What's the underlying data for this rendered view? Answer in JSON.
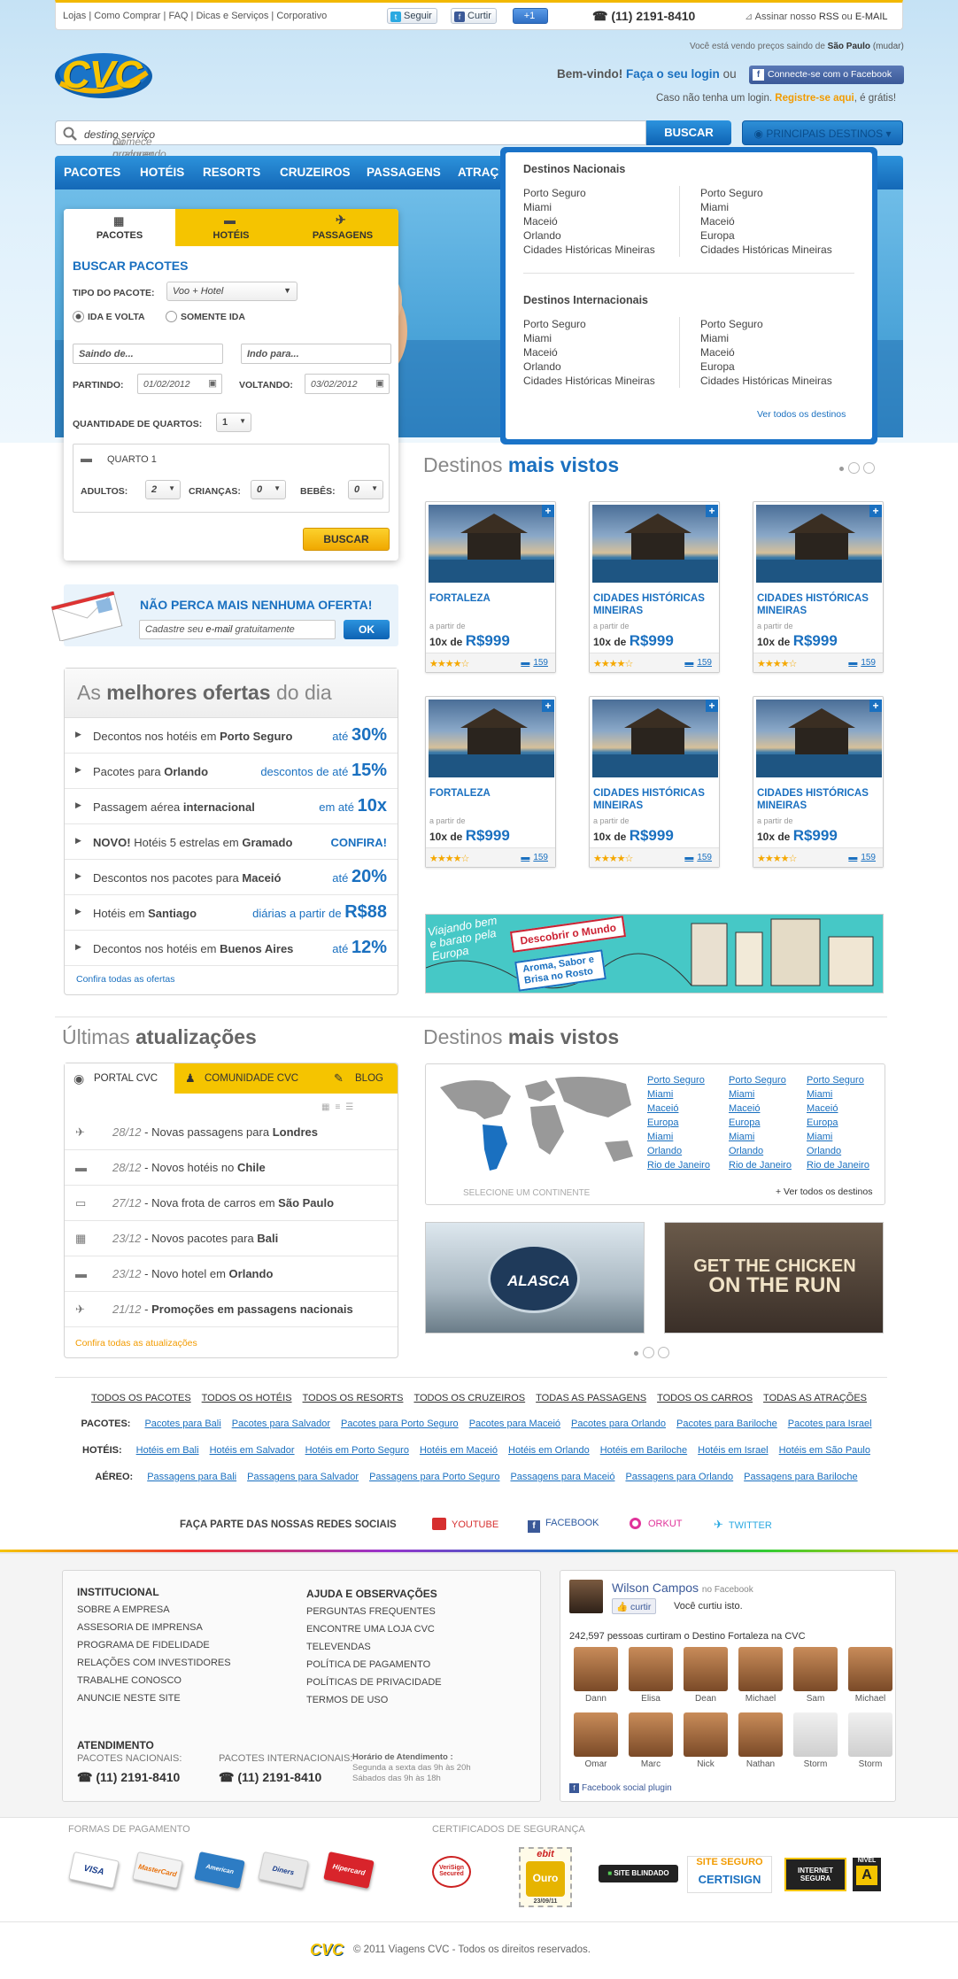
{
  "topbar": {
    "links": [
      "Lojas",
      "Como Comprar",
      "FAQ",
      "Dicas e Serviços",
      "Corporativo"
    ],
    "twitter_label": "Seguir",
    "facebook_label": "Curtir",
    "gplus_label": "+1",
    "phone": "(11) 2191-8410",
    "rss_prefix": "Assinar nosso",
    "rss_label": "RSS",
    "rss_or": "ou",
    "email_label": "E-MAIL"
  },
  "header": {
    "logo_text": "CVC",
    "location_prefix": "Você está vendo preços saindo de",
    "location_city": "São Paulo",
    "location_change": "(mudar)",
    "welcome": "Bem-vindo!",
    "login_link": "Faça o seu login",
    "or": "ou",
    "facebook_connect": "Connecte-se com o Facebook",
    "no_login": "Caso não tenha um login.",
    "register_link": "Registre-se aqui",
    "register_suffix": ", é grátis!"
  },
  "search": {
    "placeholder_a": "Comece procurando o seu",
    "placeholder_b": "destino",
    "placeholder_c": "ou qualquer outro",
    "placeholder_d": "serviço",
    "placeholder_e": "...",
    "button": "BUSCAR",
    "destinations_button": "PRINCIPAIS DESTINOS"
  },
  "nav": [
    "PACOTES",
    "HOTÉIS",
    "RESORTS",
    "CRUZEIROS",
    "PASSAGENS",
    "ATRAÇ"
  ],
  "dropdown": {
    "national_title": "Destinos Nacionais",
    "national_col1": [
      "Porto Seguro",
      "Miami",
      "Maceió",
      "Orlando",
      "Cidades Históricas Mineiras"
    ],
    "national_col2": [
      "Porto Seguro",
      "Miami",
      "Maceió",
      "Europa",
      "Cidades Históricas Mineiras"
    ],
    "intl_title": "Destinos Internacionais",
    "intl_col1": [
      "Porto Seguro",
      "Miami",
      "Maceió",
      "Orlando",
      "Cidades Históricas Mineiras"
    ],
    "intl_col2": [
      "Porto Seguro",
      "Miami",
      "Maceió",
      "Europa",
      "Cidades Históricas Mineiras"
    ],
    "see_all": "Ver todos os destinos"
  },
  "booking": {
    "tabs": [
      "PACOTES",
      "HOTÉIS",
      "PASSAGENS"
    ],
    "title": "BUSCAR PACOTES",
    "package_type_label": "TIPO DO PACOTE:",
    "package_type_value": "Voo + Hotel",
    "radio_roundtrip": "IDA E VOLTA",
    "radio_oneway": "SOMENTE IDA",
    "from_placeholder": "Saindo de...",
    "to_placeholder": "Indo para...",
    "depart_label": "PARTINDO:",
    "depart_value": "01/02/2012",
    "return_label": "VOLTANDO:",
    "return_value": "03/02/2012",
    "rooms_label": "QUANTIDADE DE QUARTOS:",
    "rooms_value": "1",
    "room_title": "QUARTO 1",
    "adults_label": "ADULTOS:",
    "adults_value": "2",
    "children_label": "CRIANÇAS:",
    "children_value": "0",
    "babies_label": "BEBÊS:",
    "babies_value": "0",
    "button": "BUSCAR"
  },
  "newsletter": {
    "title": "NÃO PERCA MAIS NENHUMA OFERTA!",
    "placeholder_a": "Cadastre seu",
    "placeholder_b": "e-mail",
    "placeholder_c": "gratuitamente",
    "button": "OK"
  },
  "offers": {
    "title_a": "As",
    "title_b": "melhores ofertas",
    "title_c": "do dia",
    "rows": [
      {
        "a": "Decontos nos hotéis em ",
        "b": "Porto Seguro",
        "pre": "até ",
        "val": "30%"
      },
      {
        "a": "Pacotes para ",
        "b": "Orlando",
        "pre": "descontos de até ",
        "val": "15%"
      },
      {
        "a": "Passagem aérea ",
        "b": "internacional",
        "pre": "em até ",
        "val": "10x"
      },
      {
        "a": "",
        "b": "NOVO!",
        "a2": " Hotéis 5 estrelas em ",
        "b2": "Gramado",
        "pre": "",
        "val": "CONFIRA!"
      },
      {
        "a": "Descontos nos pacotes para ",
        "b": "Maceió",
        "pre": "até ",
        "val": "20%"
      },
      {
        "a": "Hotéis em ",
        "b": "Santiago",
        "pre": "diárias a partir de ",
        "val": "R$88"
      },
      {
        "a": "Decontos nos hotéis em ",
        "b": "Buenos Aires",
        "pre": "até ",
        "val": "12%"
      }
    ],
    "see_all": "Confira todas as ofertas"
  },
  "destinos": {
    "title_a": "Destinos",
    "title_b": "mais vistos",
    "cards": [
      {
        "name": "FORTALEZA",
        "from": "a partir de",
        "installments": "10x de",
        "price": "R$999",
        "count": "159",
        "rating": 3.5
      },
      {
        "name": "CIDADES HISTÓRICAS MINEIRAS",
        "from": "a partir de",
        "installments": "10x de",
        "price": "R$999",
        "count": "159",
        "rating": 3.5
      },
      {
        "name": "CIDADES HISTÓRICAS MINEIRAS",
        "from": "a partir de",
        "installments": "10x de",
        "price": "R$999",
        "count": "159",
        "rating": 3.5
      },
      {
        "name": "FORTALEZA",
        "from": "a partir de",
        "installments": "10x de",
        "price": "R$999",
        "count": "159",
        "rating": 3.5
      },
      {
        "name": "CIDADES HISTÓRICAS MINEIRAS",
        "from": "a partir de",
        "installments": "10x de",
        "price": "R$999",
        "count": "159",
        "rating": 3.5
      },
      {
        "name": "CIDADES HISTÓRICAS MINEIRAS",
        "from": "a partir de",
        "installments": "10x de",
        "price": "R$999",
        "count": "159",
        "rating": 3.5
      }
    ]
  },
  "banner": {
    "left": "Viajando bem e barato pela Europa",
    "center": "Descobrir o Mundo",
    "bottom": "Aroma, Sabor e Brisa no Rosto"
  },
  "updates": {
    "title_a": "Últimas",
    "title_b": "atualizações",
    "tabs": [
      "PORTAL CVC",
      "COMUNIDADE CVC",
      "BLOG"
    ],
    "rows": [
      {
        "date": "28/12",
        "text": " - Novas passagens para ",
        "bold": "Londres"
      },
      {
        "date": "28/12",
        "text": " - Novos hotéis no ",
        "bold": "Chile"
      },
      {
        "date": "27/12",
        "text": " - Nova frota de carros em ",
        "bold": "São Paulo"
      },
      {
        "date": "23/12",
        "text": " - Novos pacotes para ",
        "bold": "Bali"
      },
      {
        "date": "23/12",
        "text": " - Novo hotel em ",
        "bold": "Orlando"
      },
      {
        "date": "21/12",
        "text": " - ",
        "bold": "Promoções em passagens nacionais"
      }
    ],
    "see_all": "Confira todas as atualizações"
  },
  "map": {
    "title_a": "Destinos",
    "title_b": "mais vistos",
    "col1": [
      "Porto Seguro",
      "Miami",
      "Maceió",
      "Europa",
      "Miami",
      "Orlando",
      "Rio de Janeiro"
    ],
    "col2": [
      "Porto Seguro",
      "Miami",
      "Maceió",
      "Europa",
      "Miami",
      "Orlando",
      "Rio de Janeiro"
    ],
    "col3": [
      "Porto Seguro",
      "Miami",
      "Maceió",
      "Europa",
      "Miami",
      "Orlando",
      "Rio de Janeiro"
    ],
    "select_continent": "SELECIONE UM CONTINENTE",
    "see_all": "+ Ver todos os destinos",
    "promo1": "ALASCA",
    "promo2_a": "GET THE CHICKEN",
    "promo2_b": "ON THE RUN"
  },
  "footer_nav": {
    "main": [
      "TODOS OS PACOTES",
      "TODOS OS HOTÉIS",
      "TODOS OS RESORTS",
      "TODOS OS CRUZEIROS",
      "TODAS AS PASSAGENS",
      "TODOS OS CARROS",
      "TODAS AS ATRAÇÕES"
    ],
    "pacotes_label": "PACOTES:",
    "pacotes": [
      "Pacotes para Bali",
      "Pacotes para Salvador",
      "Pacotes para Porto Seguro",
      "Pacotes para Maceió",
      "Pacotes para Orlando",
      "Pacotes para Bariloche",
      "Pacotes para Israel"
    ],
    "hoteis_label": "HOTÉIS:",
    "hoteis": [
      "Hotéis em Bali",
      "Hotéis em Salvador",
      "Hotéis em Porto Seguro",
      "Hotéis em Maceió",
      "Hotéis em Orlando",
      "Hotéis em Bariloche",
      "Hotéis em Israel",
      "Hotéis em São Paulo"
    ],
    "aereo_label": "AÉREO:",
    "aereo": [
      "Passagens para Bali",
      "Passagens para Salvador",
      "Passagens para Porto Seguro",
      "Passagens para Maceió",
      "Passagens para Orlando",
      "Passagens para Bariloche"
    ]
  },
  "social": {
    "label": "FAÇA PARTE DAS NOSSAS REDES SOCIAIS",
    "youtube": "YOUTUBE",
    "facebook": "FACEBOOK",
    "orkut": "ORKUT",
    "twitter": "TWITTER"
  },
  "footer": {
    "inst_title": "INSTITUCIONAL",
    "inst": [
      "SOBRE A EMPRESA",
      "ASSESORIA DE IMPRENSA",
      "PROGRAMA DE FIDELIDADE",
      "RELAÇÕES COM INVESTIDORES",
      "TRABALHE CONOSCO",
      "ANUNCIE NESTE SITE"
    ],
    "help_title": "AJUDA E OBSERVAÇÕES",
    "help": [
      "PERGUNTAS FREQUENTES",
      "ENCONTRE UMA LOJA CVC",
      "TELEVENDAS",
      "POLÍTICA DE PAGAMENTO",
      "POLÍTICAS DE PRIVACIDADE",
      "TERMOS DE USO"
    ],
    "atend_title": "ATENDIMENTO",
    "nac_label": "PACOTES NACIONAIS:",
    "nac_phone": "(11) 2191-8410",
    "int_label": "PACOTES INTERNACIONAIS:",
    "int_phone": "(11) 2191-8410",
    "hours_title": "Horário de Atendimento :",
    "hours1": "Segunda a sexta das 9h às 20h",
    "hours2": "Sábados das 9h às 18h"
  },
  "fbplugin": {
    "name": "Wilson Campos",
    "on": "no Facebook",
    "like_btn": "curtir",
    "liked": "Você curtiu isto.",
    "count_text": "242,597 pessoas curtiram o Destino Fortaleza na CVC",
    "people": [
      "Dann",
      "Elisa",
      "Dean",
      "Michael",
      "Sam",
      "Michael",
      "Omar",
      "Marc",
      "Nick",
      "Nathan",
      "Storm",
      "Storm"
    ],
    "plugin": "Facebook social plugin"
  },
  "payments": {
    "title": "FORMAS DE PAGAMENTO",
    "cards": [
      "VISA",
      "MasterCard",
      "American Express",
      "Diners",
      "Hipercard"
    ],
    "cert_title": "CERTIFICADOS DE SEGURANÇA",
    "verisign": "VeriSign Secured",
    "ebit_date": "23/09/11",
    "ebit_level": "Ouro",
    "blindado": "SITE BLINDADO",
    "certisign_a": "SITE SEGURO",
    "certisign_b": "CERTISIGN",
    "internet": "INTERNET SEGURA",
    "nivel": "NÍVEL",
    "nivel_val": "A"
  },
  "copyright": "© 2011 Viagens CVC - Todos os direitos reservados.",
  "copyright_logo": "CVC",
  "colors": {
    "brand_blue": "#1a70c0",
    "brand_yellow": "#f5c400"
  }
}
